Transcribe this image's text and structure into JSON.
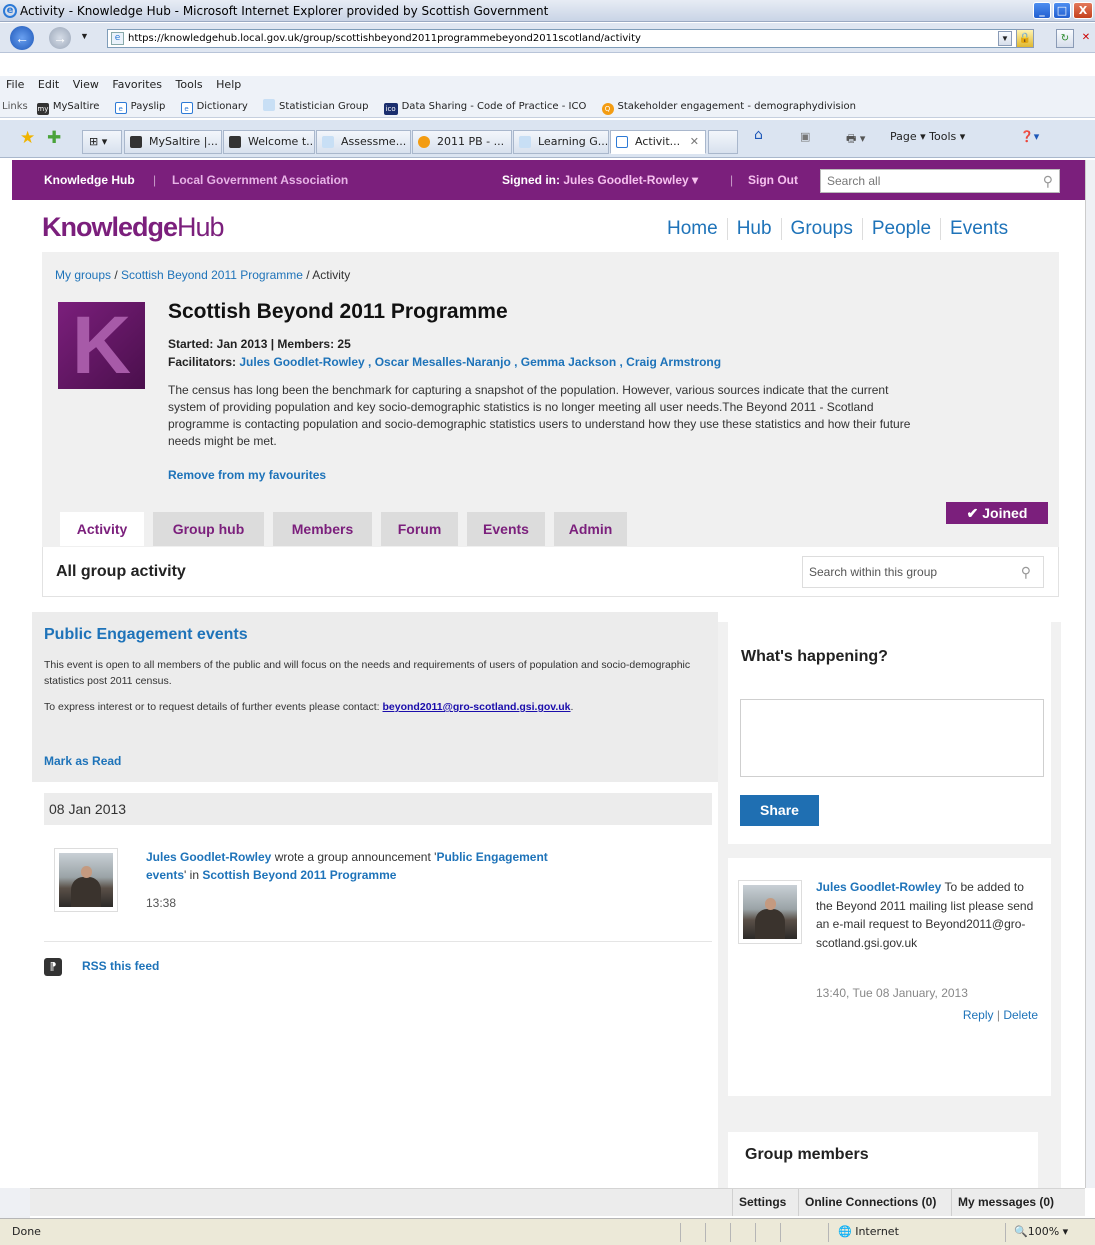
{
  "browser": {
    "title": "Activity - Knowledge Hub - Microsoft Internet Explorer provided by Scottish Government",
    "url": "https://knowledgehub.local.gov.uk/group/scottishbeyond2011programmebeyond2011scotland/activity",
    "menu": [
      "File",
      "Edit",
      "View",
      "Favorites",
      "Tools",
      "Help"
    ],
    "links_label": "Links",
    "links": [
      "MySaltire",
      "Payslip",
      "Dictionary",
      "Statistician Group",
      "Data Sharing - Code of Practice - ICO",
      "Stakeholder engagement - demographydivision"
    ],
    "tabs": [
      "MySaltire |...",
      "Welcome t...",
      "Assessme...",
      "2011 PB - ...",
      "Learning G...",
      "Activit..."
    ],
    "toolbar_tools": "Page ▾   Tools ▾",
    "status": "Done",
    "zone": "Internet",
    "zoom": "100%"
  },
  "topbar": {
    "brand": "Knowledge Hub",
    "org": "Local Government Association",
    "signed_in_label": "Signed in:",
    "user": "Jules Goodlet-Rowley",
    "sign_out": "Sign Out",
    "search_placeholder": "Search all"
  },
  "logo": {
    "strong": "Knowledge",
    "light": "Hub"
  },
  "mainnav": [
    "Home",
    "Hub",
    "Groups",
    "People",
    "Events"
  ],
  "group": {
    "crumb_mygroups": "My groups",
    "crumb_group": "Scottish Beyond 2011 Programme",
    "crumb_current": "Activity",
    "logo_letter": "K",
    "title": "Scottish Beyond 2011 Programme",
    "started": "Started: Jan 2013 | Members: 25",
    "facilitators_label": "Facilitators:",
    "facilitators": "Jules Goodlet-Rowley , Oscar Mesalles-Naranjo , Gemma Jackson , Craig Armstrong",
    "description": "The census has long been the benchmark for capturing a snapshot of the population.  However, various sources indicate that the current system of providing population and key socio-demographic statistics is no longer meeting all user needs.The Beyond 2011 - Scotland programme is contacting population and socio-demographic statistics users to understand how they use these statistics and how their future needs might be met.",
    "remove_fav": "Remove from my favourites",
    "joined": "Joined",
    "tabs": [
      "Activity",
      "Group hub",
      "Members",
      "Forum",
      "Events",
      "Admin"
    ]
  },
  "activity": {
    "title": "All group activity",
    "search_placeholder": "Search within this group"
  },
  "announcement": {
    "title": "Public Engagement events",
    "body": "This event is open to all members of the public and will focus on the needs and requirements of users of population and socio-demographic statistics post 2011 census.",
    "contact_text": "To express interest or to request details of further events please contact: ",
    "contact_email": "beyond2011@gro-scotland.gsi.gov.uk",
    "mark_read": "Mark as Read"
  },
  "feed": {
    "date": "08 Jan 2013",
    "author": "Jules Goodlet-Rowley",
    "wrote": " wrote a group announcement '",
    "item": "Public Engagement events",
    "in": "' in ",
    "group": "Scottish Beyond 2011 Programme",
    "time": "13:38",
    "rss": "RSS this feed"
  },
  "happening": {
    "title": "What's happening?",
    "share": "Share",
    "author": "Jules Goodlet-Rowley",
    "text": " To be added to the Beyond 2011 mailing list please send an e-mail request to Beyond2011@gro-scotland.gsi.gov.uk",
    "time": "13:40, Tue 08 January, 2013",
    "reply": "Reply",
    "delete": "Delete"
  },
  "members_title": "Group members",
  "sitebar": {
    "settings": "Settings",
    "online": "Online Connections (0)",
    "messages": "My messages (0)"
  },
  "colors": {
    "brand": "#7b1f7c",
    "link": "#1e73b9",
    "share": "#1f6fb2"
  }
}
